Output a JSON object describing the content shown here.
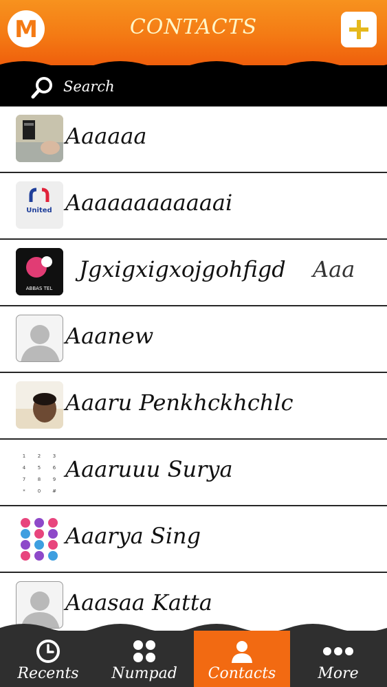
{
  "header": {
    "title": "CONTACTS",
    "logo_letter": "M",
    "add_icon": "plus-icon",
    "accent": "#f47a14"
  },
  "search": {
    "label": "Search",
    "icon": "search-icon"
  },
  "contacts": [
    {
      "name": "Aaaaaa",
      "avatar": "photo-phone"
    },
    {
      "name": "Aaaaaaaaaaaai",
      "avatar": "united-logo",
      "avatar_text": "United"
    },
    {
      "name": "Jgxigxigxojgohfigd",
      "extra": "Aaa",
      "avatar": "abbas-tel-logo",
      "avatar_text": "ABBAS TEL"
    },
    {
      "name": "Aaanew",
      "avatar": "default-person"
    },
    {
      "name": "Aaaru Penkhckhchlc",
      "avatar": "photo-person"
    },
    {
      "name": "Aaaruuu Surya",
      "avatar": "numpad",
      "keypad": [
        "1",
        "2",
        "3",
        "4",
        "5",
        "6",
        "7",
        "8",
        "9",
        "*",
        "0",
        "#"
      ]
    },
    {
      "name": "Aaarya Sing",
      "avatar": "colored-numpad"
    },
    {
      "name": "Aaasaa Katta",
      "avatar": "default-person"
    }
  ],
  "nav": {
    "items": [
      {
        "label": "Recents",
        "icon": "clock-icon"
      },
      {
        "label": "Numpad",
        "icon": "numpad-icon"
      },
      {
        "label": "Contacts",
        "icon": "person-icon",
        "active": true
      },
      {
        "label": "More",
        "icon": "more-icon"
      }
    ]
  }
}
